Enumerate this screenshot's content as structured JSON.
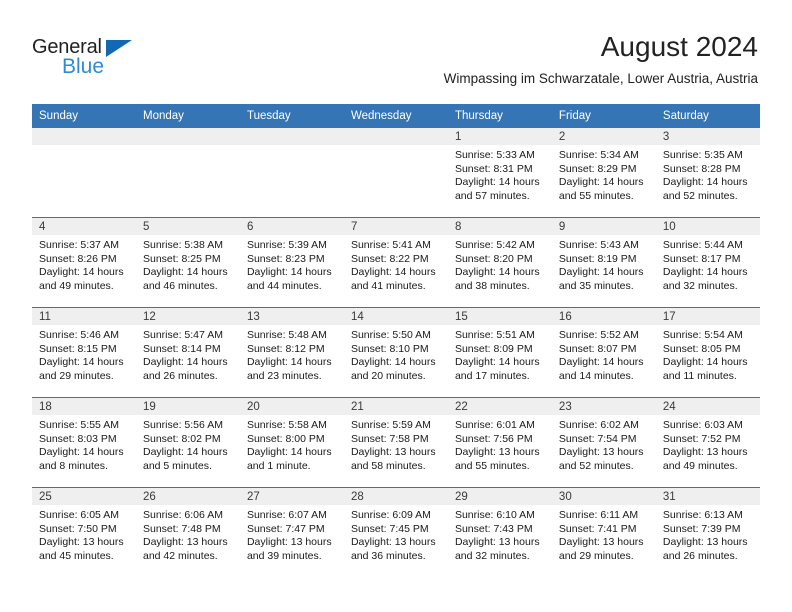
{
  "brand": {
    "name_part1": "General",
    "name_part2": "Blue",
    "accent_color": "#2e8bd6",
    "triangle_color": "#1268b3"
  },
  "header": {
    "title": "August 2024",
    "subtitle": "Wimpassing im Schwarzatale, Lower Austria, Austria"
  },
  "calendar": {
    "header_bg": "#3575b5",
    "daynum_bg": "#efefef",
    "weekdays": [
      "Sunday",
      "Monday",
      "Tuesday",
      "Wednesday",
      "Thursday",
      "Friday",
      "Saturday"
    ],
    "weeks": [
      [
        {
          "day": "",
          "empty": true
        },
        {
          "day": "",
          "empty": true
        },
        {
          "day": "",
          "empty": true
        },
        {
          "day": "",
          "empty": true
        },
        {
          "day": "1",
          "sunrise": "Sunrise: 5:33 AM",
          "sunset": "Sunset: 8:31 PM",
          "daylight_l1": "Daylight: 14 hours",
          "daylight_l2": "and 57 minutes."
        },
        {
          "day": "2",
          "sunrise": "Sunrise: 5:34 AM",
          "sunset": "Sunset: 8:29 PM",
          "daylight_l1": "Daylight: 14 hours",
          "daylight_l2": "and 55 minutes."
        },
        {
          "day": "3",
          "sunrise": "Sunrise: 5:35 AM",
          "sunset": "Sunset: 8:28 PM",
          "daylight_l1": "Daylight: 14 hours",
          "daylight_l2": "and 52 minutes."
        }
      ],
      [
        {
          "day": "4",
          "sunrise": "Sunrise: 5:37 AM",
          "sunset": "Sunset: 8:26 PM",
          "daylight_l1": "Daylight: 14 hours",
          "daylight_l2": "and 49 minutes."
        },
        {
          "day": "5",
          "sunrise": "Sunrise: 5:38 AM",
          "sunset": "Sunset: 8:25 PM",
          "daylight_l1": "Daylight: 14 hours",
          "daylight_l2": "and 46 minutes."
        },
        {
          "day": "6",
          "sunrise": "Sunrise: 5:39 AM",
          "sunset": "Sunset: 8:23 PM",
          "daylight_l1": "Daylight: 14 hours",
          "daylight_l2": "and 44 minutes."
        },
        {
          "day": "7",
          "sunrise": "Sunrise: 5:41 AM",
          "sunset": "Sunset: 8:22 PM",
          "daylight_l1": "Daylight: 14 hours",
          "daylight_l2": "and 41 minutes."
        },
        {
          "day": "8",
          "sunrise": "Sunrise: 5:42 AM",
          "sunset": "Sunset: 8:20 PM",
          "daylight_l1": "Daylight: 14 hours",
          "daylight_l2": "and 38 minutes."
        },
        {
          "day": "9",
          "sunrise": "Sunrise: 5:43 AM",
          "sunset": "Sunset: 8:19 PM",
          "daylight_l1": "Daylight: 14 hours",
          "daylight_l2": "and 35 minutes."
        },
        {
          "day": "10",
          "sunrise": "Sunrise: 5:44 AM",
          "sunset": "Sunset: 8:17 PM",
          "daylight_l1": "Daylight: 14 hours",
          "daylight_l2": "and 32 minutes."
        }
      ],
      [
        {
          "day": "11",
          "sunrise": "Sunrise: 5:46 AM",
          "sunset": "Sunset: 8:15 PM",
          "daylight_l1": "Daylight: 14 hours",
          "daylight_l2": "and 29 minutes."
        },
        {
          "day": "12",
          "sunrise": "Sunrise: 5:47 AM",
          "sunset": "Sunset: 8:14 PM",
          "daylight_l1": "Daylight: 14 hours",
          "daylight_l2": "and 26 minutes."
        },
        {
          "day": "13",
          "sunrise": "Sunrise: 5:48 AM",
          "sunset": "Sunset: 8:12 PM",
          "daylight_l1": "Daylight: 14 hours",
          "daylight_l2": "and 23 minutes."
        },
        {
          "day": "14",
          "sunrise": "Sunrise: 5:50 AM",
          "sunset": "Sunset: 8:10 PM",
          "daylight_l1": "Daylight: 14 hours",
          "daylight_l2": "and 20 minutes."
        },
        {
          "day": "15",
          "sunrise": "Sunrise: 5:51 AM",
          "sunset": "Sunset: 8:09 PM",
          "daylight_l1": "Daylight: 14 hours",
          "daylight_l2": "and 17 minutes."
        },
        {
          "day": "16",
          "sunrise": "Sunrise: 5:52 AM",
          "sunset": "Sunset: 8:07 PM",
          "daylight_l1": "Daylight: 14 hours",
          "daylight_l2": "and 14 minutes."
        },
        {
          "day": "17",
          "sunrise": "Sunrise: 5:54 AM",
          "sunset": "Sunset: 8:05 PM",
          "daylight_l1": "Daylight: 14 hours",
          "daylight_l2": "and 11 minutes."
        }
      ],
      [
        {
          "day": "18",
          "sunrise": "Sunrise: 5:55 AM",
          "sunset": "Sunset: 8:03 PM",
          "daylight_l1": "Daylight: 14 hours",
          "daylight_l2": "and 8 minutes."
        },
        {
          "day": "19",
          "sunrise": "Sunrise: 5:56 AM",
          "sunset": "Sunset: 8:02 PM",
          "daylight_l1": "Daylight: 14 hours",
          "daylight_l2": "and 5 minutes."
        },
        {
          "day": "20",
          "sunrise": "Sunrise: 5:58 AM",
          "sunset": "Sunset: 8:00 PM",
          "daylight_l1": "Daylight: 14 hours",
          "daylight_l2": "and 1 minute."
        },
        {
          "day": "21",
          "sunrise": "Sunrise: 5:59 AM",
          "sunset": "Sunset: 7:58 PM",
          "daylight_l1": "Daylight: 13 hours",
          "daylight_l2": "and 58 minutes."
        },
        {
          "day": "22",
          "sunrise": "Sunrise: 6:01 AM",
          "sunset": "Sunset: 7:56 PM",
          "daylight_l1": "Daylight: 13 hours",
          "daylight_l2": "and 55 minutes."
        },
        {
          "day": "23",
          "sunrise": "Sunrise: 6:02 AM",
          "sunset": "Sunset: 7:54 PM",
          "daylight_l1": "Daylight: 13 hours",
          "daylight_l2": "and 52 minutes."
        },
        {
          "day": "24",
          "sunrise": "Sunrise: 6:03 AM",
          "sunset": "Sunset: 7:52 PM",
          "daylight_l1": "Daylight: 13 hours",
          "daylight_l2": "and 49 minutes."
        }
      ],
      [
        {
          "day": "25",
          "sunrise": "Sunrise: 6:05 AM",
          "sunset": "Sunset: 7:50 PM",
          "daylight_l1": "Daylight: 13 hours",
          "daylight_l2": "and 45 minutes."
        },
        {
          "day": "26",
          "sunrise": "Sunrise: 6:06 AM",
          "sunset": "Sunset: 7:48 PM",
          "daylight_l1": "Daylight: 13 hours",
          "daylight_l2": "and 42 minutes."
        },
        {
          "day": "27",
          "sunrise": "Sunrise: 6:07 AM",
          "sunset": "Sunset: 7:47 PM",
          "daylight_l1": "Daylight: 13 hours",
          "daylight_l2": "and 39 minutes."
        },
        {
          "day": "28",
          "sunrise": "Sunrise: 6:09 AM",
          "sunset": "Sunset: 7:45 PM",
          "daylight_l1": "Daylight: 13 hours",
          "daylight_l2": "and 36 minutes."
        },
        {
          "day": "29",
          "sunrise": "Sunrise: 6:10 AM",
          "sunset": "Sunset: 7:43 PM",
          "daylight_l1": "Daylight: 13 hours",
          "daylight_l2": "and 32 minutes."
        },
        {
          "day": "30",
          "sunrise": "Sunrise: 6:11 AM",
          "sunset": "Sunset: 7:41 PM",
          "daylight_l1": "Daylight: 13 hours",
          "daylight_l2": "and 29 minutes."
        },
        {
          "day": "31",
          "sunrise": "Sunrise: 6:13 AM",
          "sunset": "Sunset: 7:39 PM",
          "daylight_l1": "Daylight: 13 hours",
          "daylight_l2": "and 26 minutes."
        }
      ]
    ]
  }
}
